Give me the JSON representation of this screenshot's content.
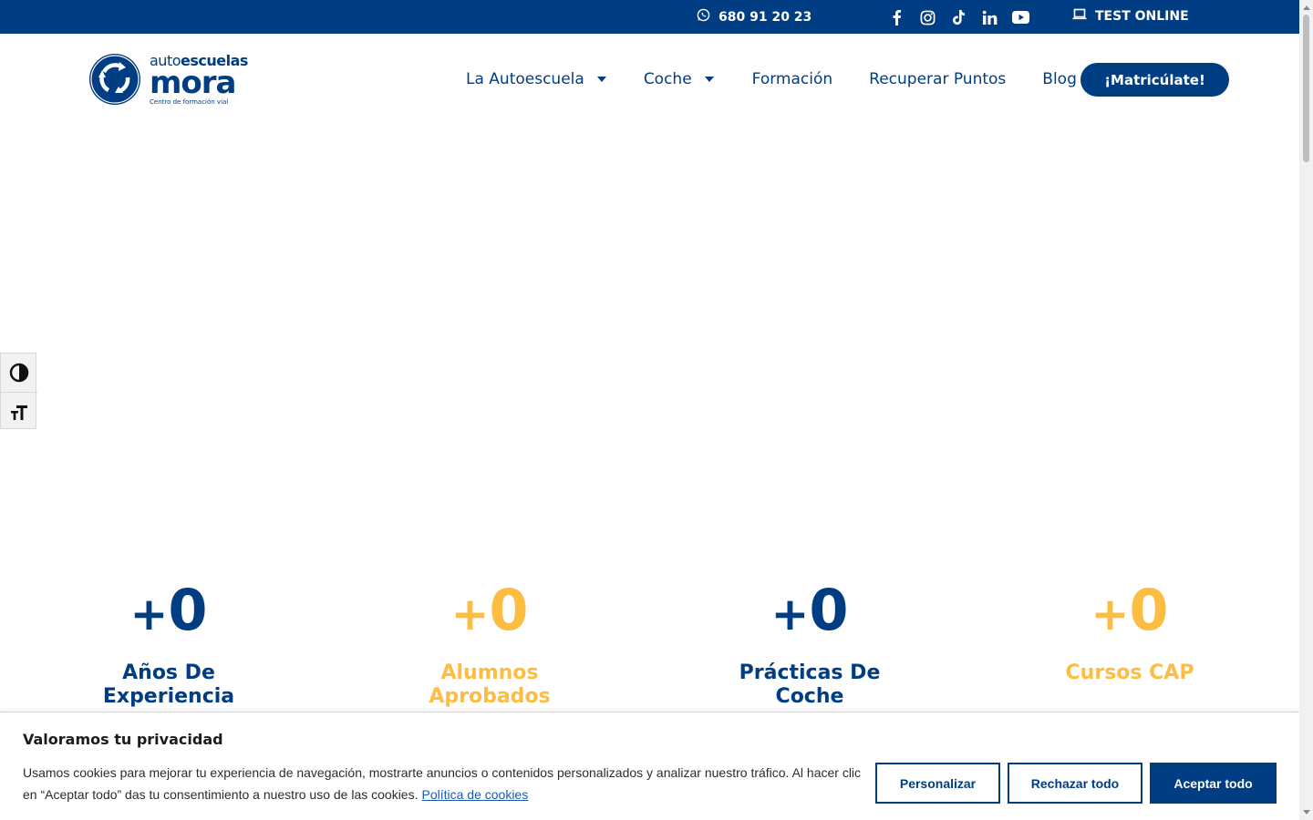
{
  "topbar": {
    "phone": "680 91 20 23",
    "socials": [
      "facebook-icon",
      "instagram-icon",
      "tiktok-icon",
      "linkedin-icon",
      "youtube-icon"
    ],
    "test_label": "TEST ONLINE"
  },
  "logo": {
    "auto": "auto",
    "escuelas": "escuelas",
    "name": "mora",
    "tagline": "Centro de formación vial"
  },
  "nav": {
    "items": [
      {
        "label": "La Autoescuela",
        "dropdown": true
      },
      {
        "label": "Coche",
        "dropdown": true
      },
      {
        "label": "Formación",
        "dropdown": false
      },
      {
        "label": "Recuperar Puntos",
        "dropdown": false
      },
      {
        "label": "Blog",
        "dropdown": false
      }
    ],
    "cta": "¡Matricúlate!"
  },
  "accessibility": {
    "icons": [
      "contrast-icon",
      "text-size-icon"
    ]
  },
  "stats": [
    {
      "plus": "+",
      "value": "0",
      "label_1": "Años De",
      "label_2": "Experiencia",
      "color": "#003d82"
    },
    {
      "plus": "+",
      "value": "0",
      "label_1": "Alumnos",
      "label_2": "Aprobados",
      "color": "#fcbd42"
    },
    {
      "plus": "+",
      "value": "0",
      "label_1": "Prácticas De",
      "label_2": "Coche",
      "color": "#003d82"
    },
    {
      "plus": "+",
      "value": "0",
      "label_1": "Cursos CAP",
      "label_2": "",
      "color": "#fcbd42"
    }
  ],
  "cookie": {
    "title": "Valoramos tu privacidad",
    "body": "Usamos cookies para mejorar tu experiencia de navegación, mostrarte anuncios o contenidos personalizados y analizar nuestro tráfico. Al hacer clic en “Aceptar todo” das tu consentimiento a nuestro uso de las cookies.",
    "link": "Política de cookies",
    "customize": "Personalizar",
    "reject": "Rechazar todo",
    "accept": "Aceptar todo"
  },
  "colors": {
    "brand_blue": "#003d82",
    "accent_yellow": "#fcbd42"
  }
}
